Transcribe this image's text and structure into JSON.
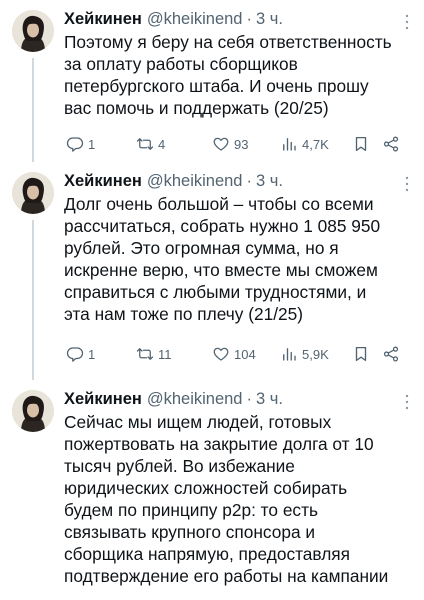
{
  "tweets": [
    {
      "author_name": "Хейкинен",
      "handle": "@kheikinend",
      "separator": "·",
      "time": "3 ч.",
      "text": "Поэтому я беру на себя ответственность\nза оплату работы сборщиков\nпетербургского штаба. И очень прошу\nвас помочь и поддержать (20/25)",
      "stats": {
        "replies": "1",
        "retweets": "4",
        "likes": "93",
        "views": "4,7K"
      }
    },
    {
      "author_name": "Хейкинен",
      "handle": "@kheikinend",
      "separator": "·",
      "time": "3 ч.",
      "text": "Долг очень большой – чтобы со всеми\nрассчитаться, собрать нужно 1 085 950\nрублей. Это огромная сумма, но я\nискренне верю, что вместе мы сможем\nсправиться с любыми трудностями, и\nэта нам тоже по плечу (21/25)",
      "stats": {
        "replies": "1",
        "retweets": "11",
        "likes": "104",
        "views": "5,9K"
      }
    },
    {
      "author_name": "Хейкинен",
      "handle": "@kheikinend",
      "separator": "·",
      "time": "3 ч.",
      "text": "Сейчас мы ищем людей, готовых\nпожертвовать на закрытие долга от 10\nтысяч рублей. Во избежание\nюридических сложностей собирать\nбудем по принципу p2p: то есть\nсвязывать крупного спонсора и\nсборщика напрямую, предоставляя\nподтверждение его работы на кампании"
    }
  ],
  "icons": {
    "reply": "reply-icon",
    "retweet": "retweet-icon",
    "like": "heart-icon",
    "views": "views-icon",
    "bookmark": "bookmark-icon",
    "share": "share-icon",
    "more": "more-icon"
  },
  "colors": {
    "text": "#0f1419",
    "secondary": "#536471",
    "thread_line": "#cfd9de"
  }
}
